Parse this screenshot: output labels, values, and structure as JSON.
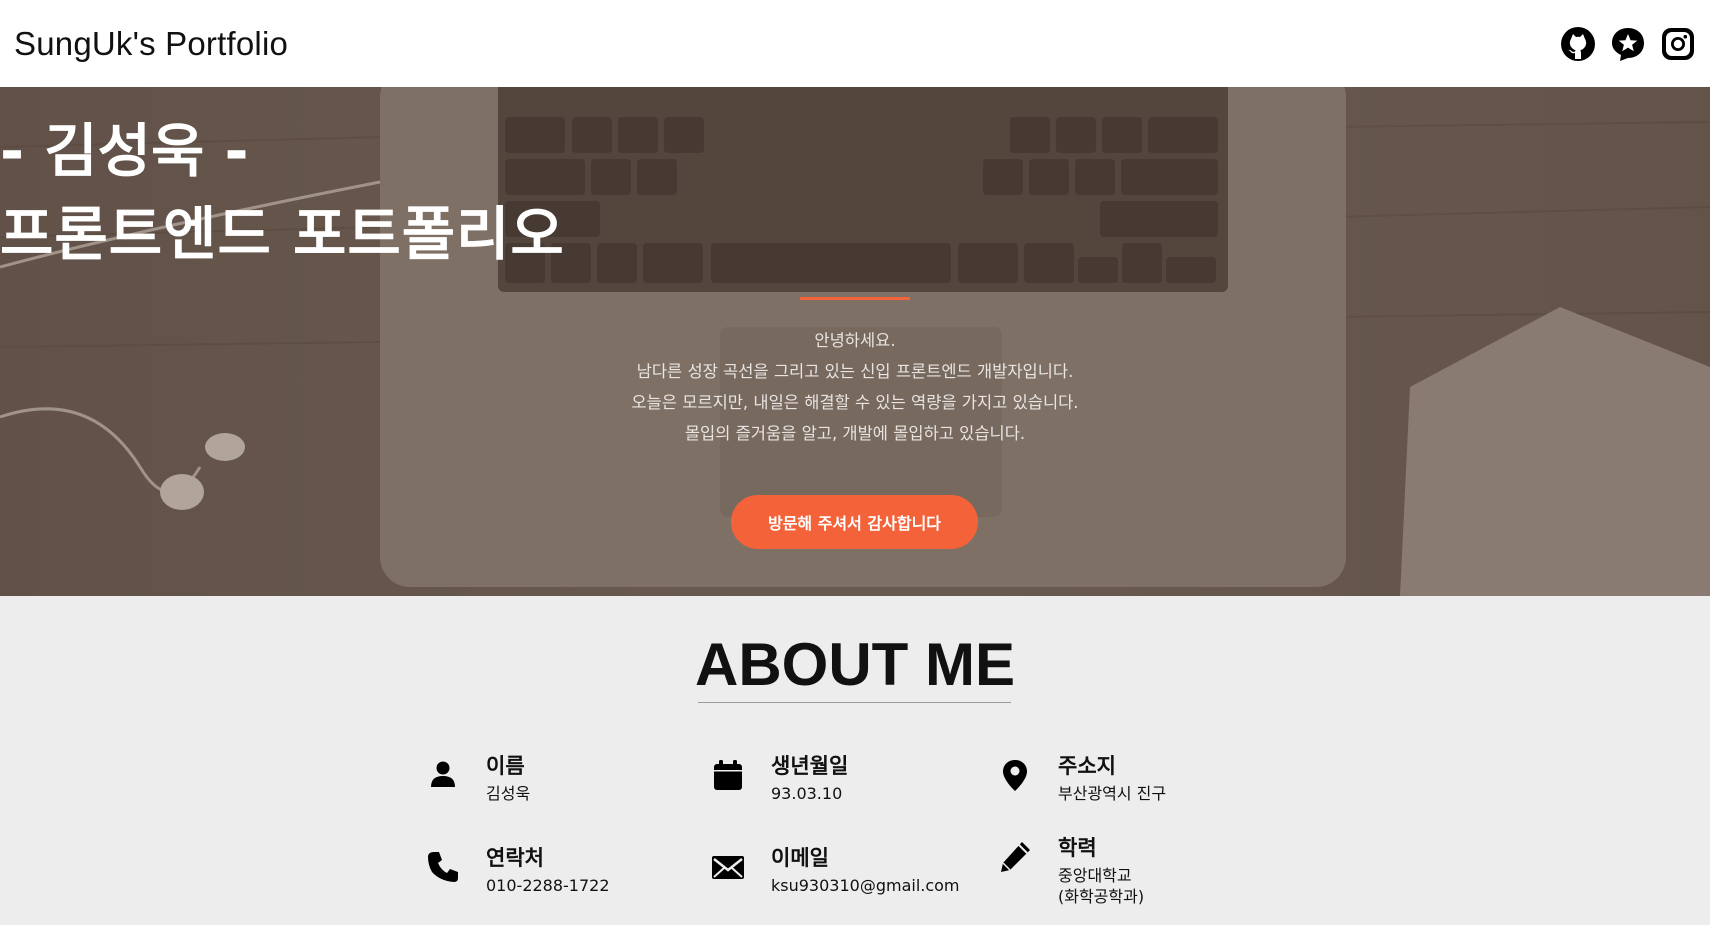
{
  "header": {
    "brand": "SungUk's Portfolio",
    "icons": [
      "github-icon",
      "star-badge-icon",
      "instagram-icon"
    ]
  },
  "hero": {
    "title_line1": "- 김성욱 -",
    "title_line2": "프론트엔드 포트폴리오",
    "intro": [
      "안녕하세요.",
      "남다른 성장 곡선을 그리고 있는 신입 프론트엔드 개발자입니다.",
      "오늘은 모르지만, 내일은 해결할 수 있는 역량을 가지고 있습니다.",
      "몰입의 즐거움을 알고, 개발에 몰입하고 있습니다."
    ],
    "cta_label": "방문해 주셔서 감사합니다",
    "accent_color": "#f4623a"
  },
  "about": {
    "title": "ABOUT ME",
    "items": [
      {
        "icon": "person-icon",
        "label": "이름",
        "value": "김성욱"
      },
      {
        "icon": "calendar-icon",
        "label": "생년월일",
        "value": "93.03.10"
      },
      {
        "icon": "location-pin-icon",
        "label": "주소지",
        "value": "부산광역시 진구"
      },
      {
        "icon": "phone-icon",
        "label": "연락처",
        "value": "010-2288-1722"
      },
      {
        "icon": "mail-icon",
        "label": "이메일",
        "value": "ksu930310@gmail.com"
      },
      {
        "icon": "pencil-icon",
        "label": "학력",
        "value": "중앙대학교",
        "value2": "(화학공학과)"
      }
    ]
  }
}
